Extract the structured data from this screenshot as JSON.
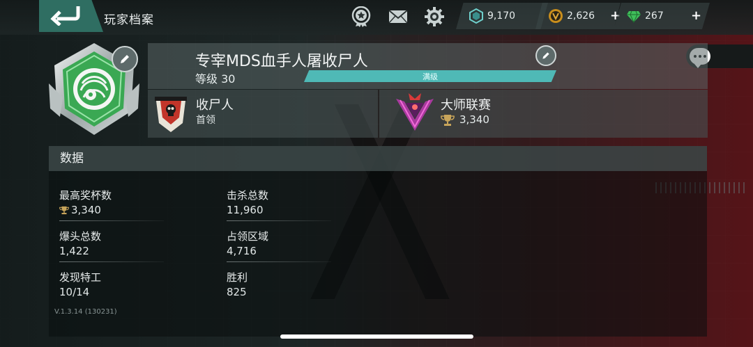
{
  "header": {
    "title": "玩家档案"
  },
  "currencies": [
    {
      "name": "credits",
      "value": "9,170",
      "has_plus": false
    },
    {
      "name": "gold",
      "value": "2,626",
      "has_plus": true
    },
    {
      "name": "gems",
      "value": "267",
      "has_plus": true
    }
  ],
  "profile": {
    "player_name": "专宰MDS血手人屠收尸人",
    "level_label": "等级 30",
    "xp_label": "满级",
    "xp_fraction": 1.0
  },
  "clan": {
    "name": "收尸人",
    "role": "首领"
  },
  "league": {
    "name": "大师联赛",
    "score": "3,340"
  },
  "stats": {
    "header": "数据",
    "items": [
      {
        "label": "最高奖杯数",
        "value": "3,340",
        "trophy": true
      },
      {
        "label": "击杀总数",
        "value": "11,960",
        "trophy": false
      },
      {
        "label": "爆头总数",
        "value": "1,422",
        "trophy": false
      },
      {
        "label": "占领区域",
        "value": "4,716",
        "trophy": false
      },
      {
        "label": "发现特工",
        "value": "10/14",
        "trophy": false
      },
      {
        "label": "胜利",
        "value": "825",
        "trophy": false
      }
    ]
  },
  "version": "V.1.3.14 (130231)",
  "colors": {
    "accent_teal": "#4fb9b6",
    "back_button": "#2f6e62",
    "avatar_green": "#3aa853"
  },
  "icons": [
    "back-arrow-icon",
    "star-badge-icon",
    "mail-icon",
    "gear-icon",
    "credit-hex-icon",
    "gold-coin-icon",
    "gem-icon",
    "plus-icon",
    "chat-icon",
    "edit-pencil-icon",
    "trophy-icon"
  ]
}
